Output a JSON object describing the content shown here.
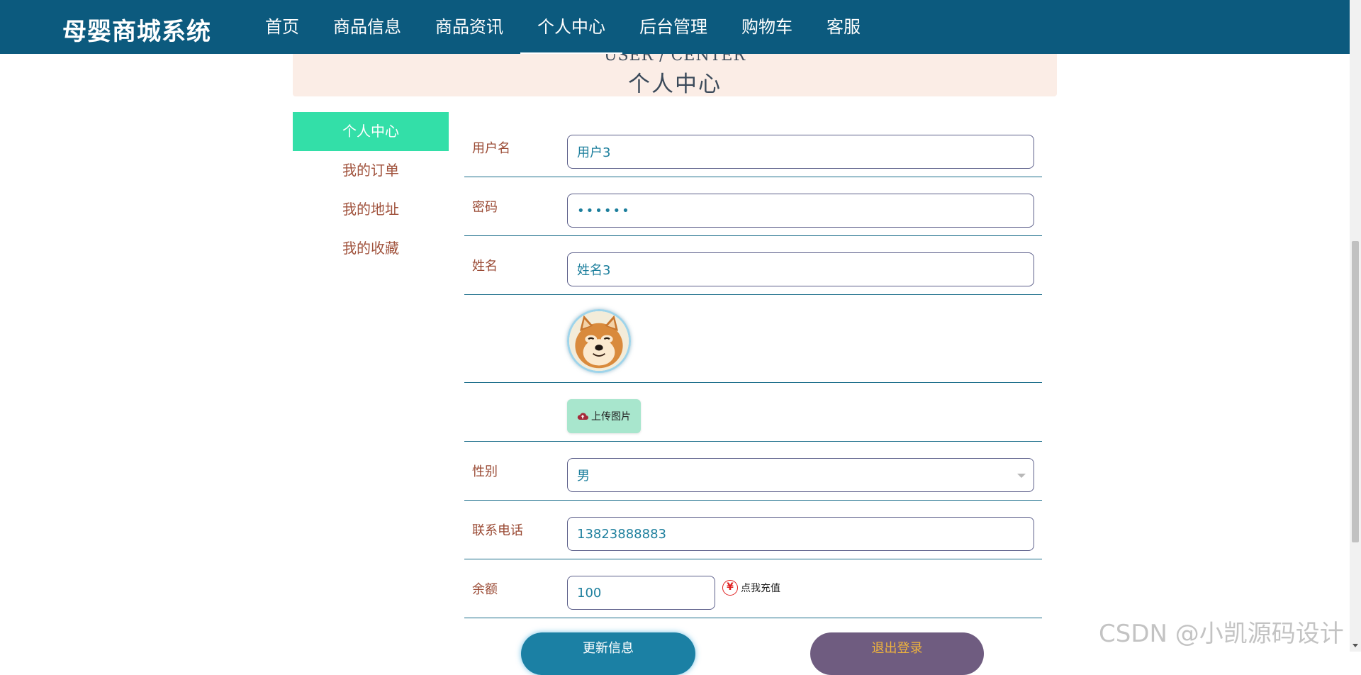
{
  "navbar": {
    "brand": "母婴商城系统",
    "items": [
      {
        "label": "首页"
      },
      {
        "label": "商品信息"
      },
      {
        "label": "商品资讯"
      },
      {
        "label": "个人中心",
        "active": true
      },
      {
        "label": "后台管理"
      },
      {
        "label": "购物车"
      },
      {
        "label": "客服"
      }
    ]
  },
  "banner": {
    "title_en": "USER / CENTER",
    "title_cn": "个人中心"
  },
  "sidebar": {
    "items": [
      {
        "label": "个人中心",
        "active": true
      },
      {
        "label": "我的订单"
      },
      {
        "label": "我的地址"
      },
      {
        "label": "我的收藏"
      }
    ]
  },
  "form": {
    "username": {
      "label": "用户名",
      "value": "用户3"
    },
    "password": {
      "label": "密码",
      "value": "••••••"
    },
    "name": {
      "label": "姓名",
      "value": "姓名3"
    },
    "upload_label": "上传图片",
    "gender": {
      "label": "性别",
      "value": "男"
    },
    "phone": {
      "label": "联系电话",
      "value": "13823888883"
    },
    "balance": {
      "label": "余额",
      "value": "100"
    },
    "recharge_symbol": "¥",
    "recharge_label": "点我充值"
  },
  "actions": {
    "update_label": "更新信息",
    "logout_label": "退出登录"
  },
  "watermark": "CSDN @小凯源码设计",
  "colors": {
    "navbar": "#0c5a7e",
    "sidebar_active": "#33dfa8",
    "label_text": "#9a4a34",
    "input_text": "#1d7f9d",
    "update_button": "#1b80a4",
    "logout_button": "#6f5c80"
  }
}
